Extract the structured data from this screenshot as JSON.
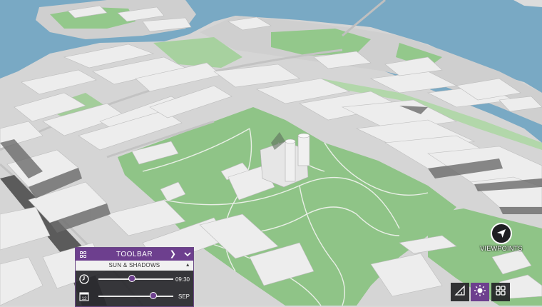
{
  "toolbar": {
    "title": "TOOLBAR",
    "section": "SUN & SHADOWS",
    "time": {
      "value": "09:30",
      "level": 0.45
    },
    "date": {
      "icon_text": "12",
      "value": "SEP",
      "level": 0.73
    }
  },
  "viewpoints": {
    "label": "VIEWPOINTS"
  },
  "colors": {
    "accent": "#6d3f8e",
    "water": "#79a9c4",
    "park": "#8fc487",
    "building": "#ececec",
    "ground": "#d6d6d6"
  },
  "icons": {
    "toolbar_logo": "grid-logo-icon",
    "next": "chevron-right-icon",
    "collapse": "chevron-down-icon",
    "section_toggle": "caret-up-icon",
    "time": "clock-icon",
    "date": "calendar-icon",
    "measure": "measure-angle-icon",
    "sun": "sun-icon",
    "apps": "grid-icon",
    "viewpoints": "navigation-arrow-icon"
  }
}
